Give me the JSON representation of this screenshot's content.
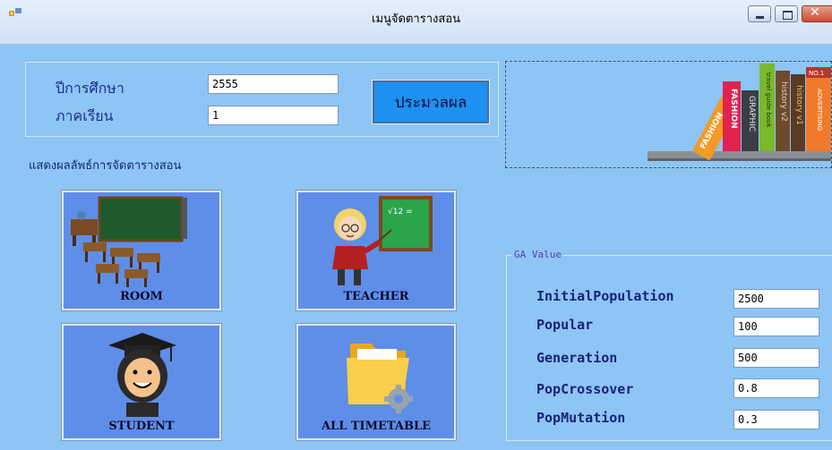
{
  "window": {
    "title": "เมนูจัดตารางสอน",
    "close_glyph": "✕"
  },
  "form": {
    "year_label": "ปีการศึกษา",
    "year_value": "2555",
    "term_label": "ภาคเรียน",
    "term_value": "1",
    "process_button": "ประมวลผล"
  },
  "banner": {
    "book_titles": [
      "FASHION",
      "FASHION",
      "GRAPHIC",
      "travel guide book",
      "history v2",
      "history v1",
      "ADVERTISING"
    ],
    "book_badge": "NO.1"
  },
  "results": {
    "label": "แสดงผลลัพธ์การจัดตารางสอน",
    "tiles": [
      {
        "label": "ROOM",
        "icon": "classroom-icon"
      },
      {
        "label": "TEACHER",
        "icon": "teacher-icon"
      },
      {
        "label": "STUDENT",
        "icon": "student-graduate-icon"
      },
      {
        "label": "ALL TIMETABLE",
        "icon": "folder-gear-icon"
      }
    ],
    "chalkboard_text": "√12 ="
  },
  "ga": {
    "legend": "GA Value",
    "params": [
      {
        "label": "InitialPopulation",
        "value": "2500"
      },
      {
        "label": "Popular",
        "value": "100"
      },
      {
        "label": "Generation",
        "value": "500"
      },
      {
        "label": "PopCrossover",
        "value": "0.8"
      },
      {
        "label": "PopMutation",
        "value": "0.3"
      }
    ]
  },
  "colors": {
    "client_bg": "#8ec5f4",
    "tile_bg": "#5f8ee8",
    "process_button_bg": "#1e90ef",
    "label_blue": "#1b2f8f"
  }
}
